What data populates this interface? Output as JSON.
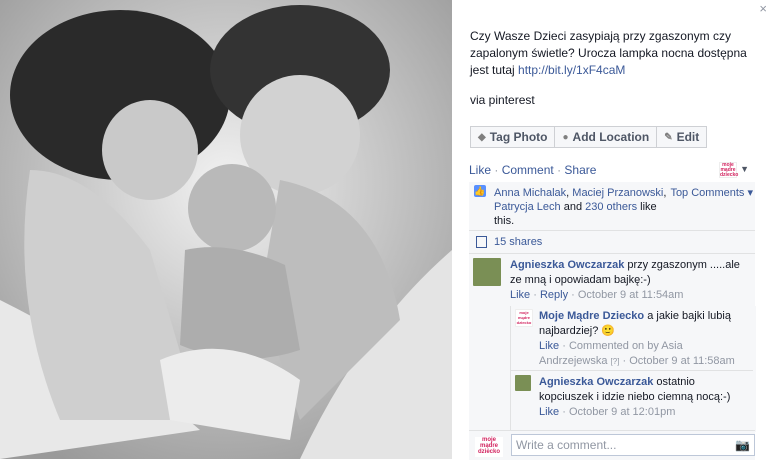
{
  "close_glyph": "×",
  "post": {
    "caption_text": "Czy Wasze Dzieci zasypiają przy zgaszonym czy zapalonym świetle? Urocza lampka nocna dostępna jest tutaj ",
    "caption_link": "http://bit.ly/1xF4caM",
    "via_text": "via pinterest"
  },
  "actions": {
    "tag_photo": "Tag Photo",
    "add_location": "Add Location",
    "edit": "Edit"
  },
  "ufi": {
    "like": "Like",
    "comment": "Comment",
    "share": "Share",
    "dot": "·",
    "likers_1": "Anna Michalak",
    "likers_2": "Maciej Przanowski",
    "likers_3": "Patrycja Lech",
    "likers_others": "230 others",
    "likers_and": " and ",
    "likers_tail": " like this.",
    "top_comments": "Top Comments ▾",
    "shares": "15 shares"
  },
  "comments": [
    {
      "author": "Agnieszka Owczarzak",
      "text": " przy zgaszonym .....ale ze mną i opowiadam bajkę:-)",
      "like": "Like",
      "reply": "Reply",
      "time": "October 9 at 11:54am"
    }
  ],
  "replies": [
    {
      "author": "Moje Mądre Dziecko",
      "text": " a jakie bajki lubią najbardziej? 🙂",
      "like": "Like",
      "commented_on": "Commented on by Asia Andrzejewska",
      "marker": "[?]",
      "time": "October 9 at 11:58am"
    },
    {
      "author": "Agnieszka Owczarzak",
      "text": " ostatnio kopciuszek i idzie niebo ciemną nocą:-)",
      "like": "Like",
      "time": "October 9 at 12:01pm"
    }
  ],
  "write_placeholder": "Write a comment...",
  "page_logo_text": "moje mądre dziecko",
  "icons": {
    "thumb": "thumbs-up-icon",
    "share": "share-icon",
    "tag": "tag-icon",
    "location": "location-pin-icon",
    "edit": "pencil-icon",
    "camera": "camera-icon"
  },
  "colors": {
    "link": "#3b5998",
    "ufi_bg": "#f6f7f9",
    "brand_pink": "#d2235f"
  }
}
